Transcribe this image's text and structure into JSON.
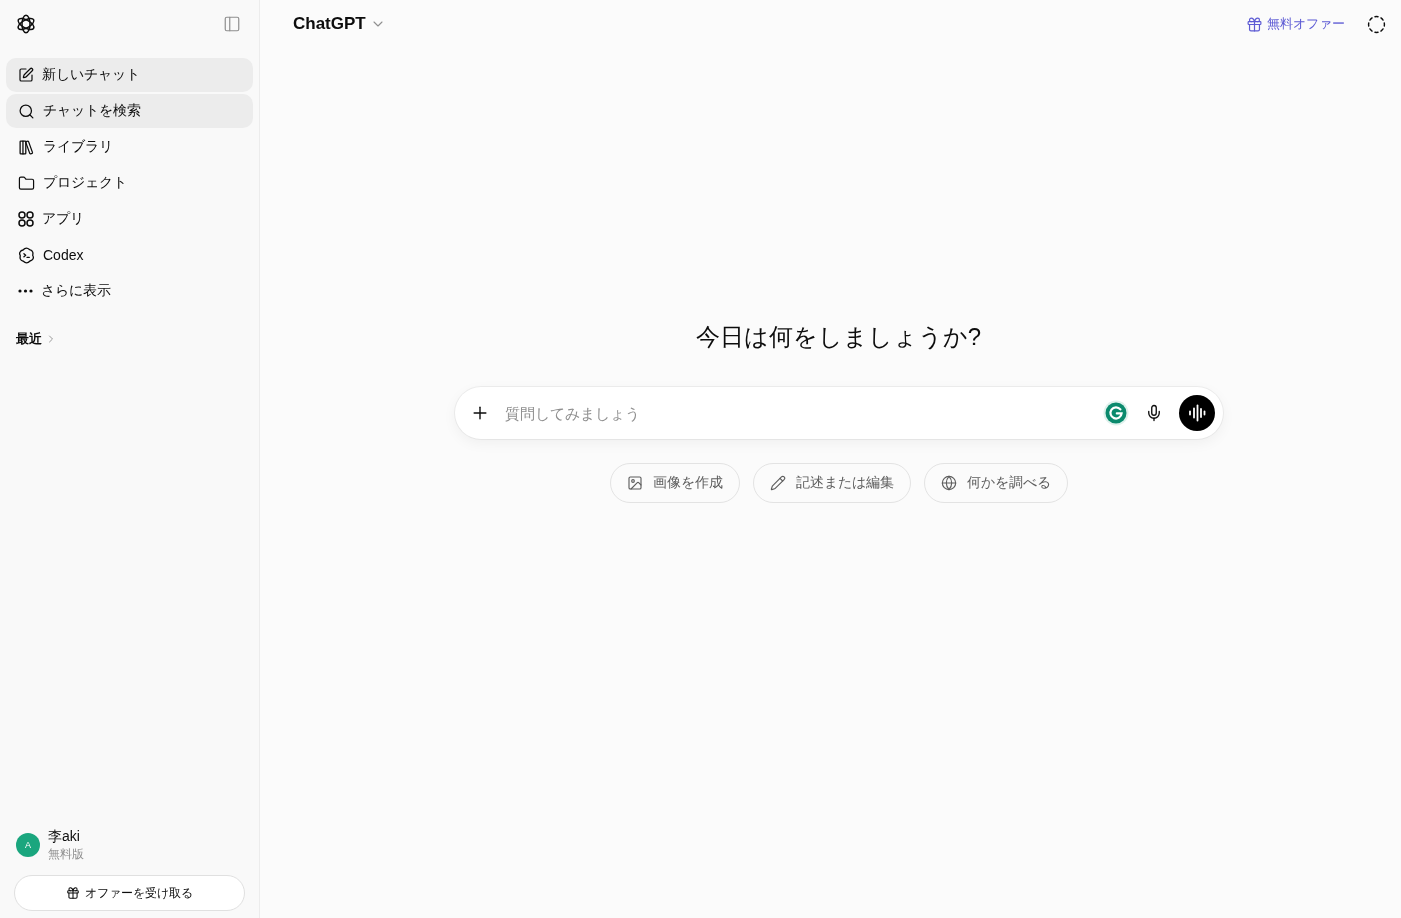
{
  "sidebar": {
    "nav_items": [
      {
        "label": "新しいチャット",
        "kind": "compose",
        "highlighted": true
      },
      {
        "label": "チャットを検索",
        "kind": "search",
        "highlighted": true
      },
      {
        "label": "ライブラリ",
        "kind": "library",
        "highlighted": false
      },
      {
        "label": "プロジェクト",
        "kind": "folder",
        "highlighted": false
      },
      {
        "label": "アプリ",
        "kind": "apps",
        "highlighted": false
      },
      {
        "label": "Codex",
        "kind": "codex",
        "highlighted": false
      },
      {
        "label": "さらに表示",
        "kind": "more",
        "highlighted": false
      }
    ],
    "recent": {
      "label": "最近",
      "expanded": false
    },
    "user": {
      "avatar_initial": "A",
      "name": "李aki",
      "plan": "無料版"
    },
    "offer_button": {
      "label": "オファーを受け取る"
    }
  },
  "header": {
    "model": "ChatGPT",
    "offer_link": "無料オファー"
  },
  "main": {
    "heading": "今日は何をしましょうか?",
    "composer": {
      "placeholder": "質問してみましょう"
    },
    "suggestions": [
      {
        "label": "画像を作成",
        "kind": "image"
      },
      {
        "label": "記述または編集",
        "kind": "write"
      },
      {
        "label": "何かを調べる",
        "kind": "research"
      }
    ]
  }
}
